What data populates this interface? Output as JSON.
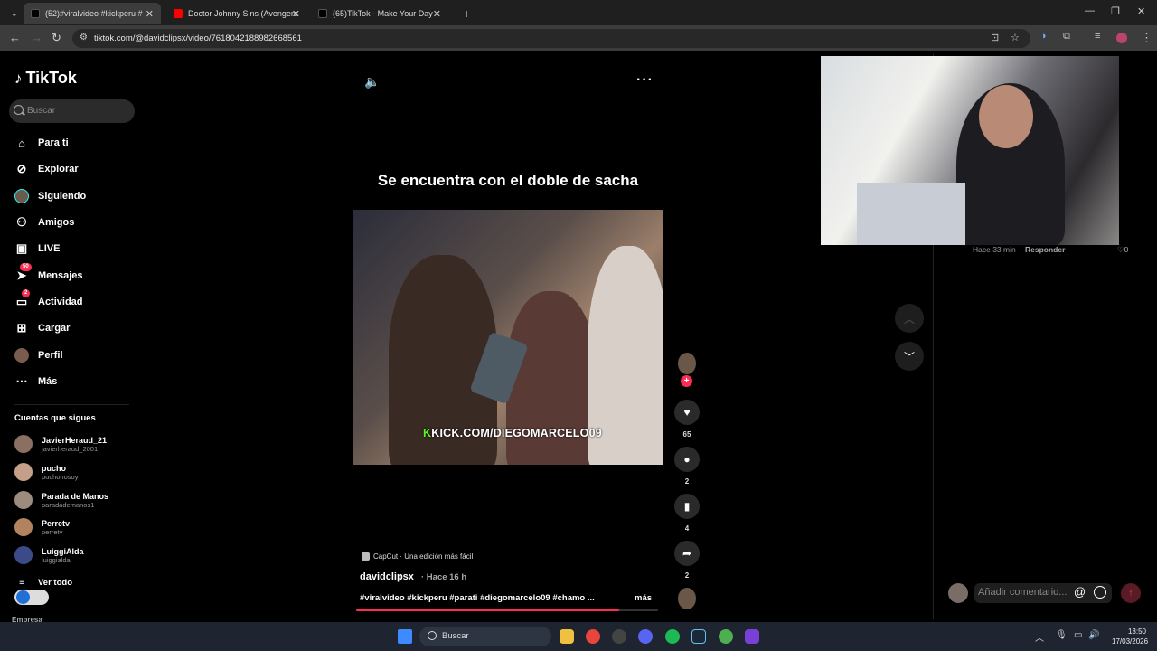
{
  "browser": {
    "tabs": [
      {
        "label": "(52)#viralvideo #kickperu #",
        "active": true,
        "favicon": "tiktok-icon"
      },
      {
        "label": "Doctor Johnny Sins (Avengers",
        "active": false,
        "favicon": "youtube-icon"
      },
      {
        "label": "(65)TikTok - Make Your Day",
        "active": false,
        "favicon": "tiktok-icon"
      }
    ],
    "url": "tiktok.com/@davidclipsx/video/7618042188982668561"
  },
  "sidebar": {
    "logo": "TikTok",
    "search_placeholder": "Buscar",
    "nav": [
      {
        "label": "Para ti",
        "icon": "home-icon"
      },
      {
        "label": "Explorar",
        "icon": "compass-icon"
      },
      {
        "label": "Siguiendo",
        "icon": "following-avatar-icon"
      },
      {
        "label": "Amigos",
        "icon": "friends-icon"
      },
      {
        "label": "LIVE",
        "icon": "live-icon"
      },
      {
        "label": "Mensajes",
        "icon": "messages-icon",
        "badge": "50"
      },
      {
        "label": "Actividad",
        "icon": "activity-icon",
        "badge": "2"
      },
      {
        "label": "Cargar",
        "icon": "upload-icon"
      },
      {
        "label": "Perfil",
        "icon": "profile-icon"
      },
      {
        "label": "Más",
        "icon": "more-icon"
      }
    ],
    "following_title": "Cuentas que sigues",
    "following": [
      {
        "name": "JavierHeraud_21",
        "handle": "javierheraud_2001"
      },
      {
        "name": "pucho",
        "handle": "puchonosoy"
      },
      {
        "name": "Parada de Manos",
        "handle": "paradademanos1"
      },
      {
        "name": "Perretv",
        "handle": "perretv"
      },
      {
        "name": "LuiggiAlda",
        "handle": "luiggialda"
      }
    ],
    "see_all": "Ver todo",
    "footer_partial": "Empresa"
  },
  "video": {
    "overlay_title": "Se encuentra con el doble de sacha",
    "watermark_text": "KICK.COM/DIEGOMARCELO09",
    "capcut_label": "CapCut · Una edición más fácil",
    "author": "davidclipsx",
    "posted": "· Hace 16 h",
    "hashtags": "#viralvideo #kickperu #parati #diegomarcelo09 #chamo ...",
    "more_label": "más",
    "progress": 0.87
  },
  "actions": {
    "likes": "65",
    "comments": "2",
    "saves": "4",
    "shares": "2"
  },
  "comments": {
    "time": "Hace 33 min",
    "reply": "Responder",
    "likes": "0",
    "input_placeholder": "Añadir comentario..."
  },
  "taskbar": {
    "search_label": "Buscar",
    "time": "13:50",
    "date": "17/03/2026"
  },
  "colors": {
    "accent": "#fe2c55",
    "kick_green": "#53fc18"
  }
}
